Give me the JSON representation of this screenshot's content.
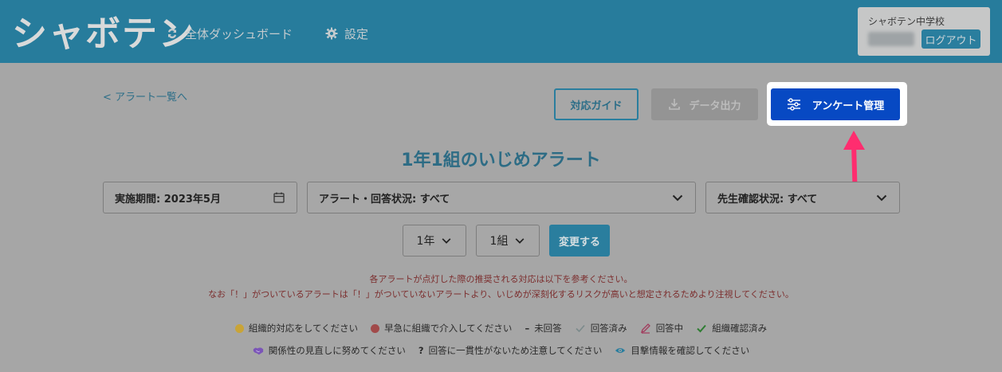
{
  "header": {
    "logo": "シャボテン",
    "nav_dashboard": "全体ダッシュボード",
    "nav_settings": "設定",
    "school_name": "シャボテン中学校",
    "logout_label": "ログアウト"
  },
  "toolbar": {
    "back_link": "< アラート一覧へ",
    "guide_label": "対応ガイド",
    "export_label": "データ出力",
    "survey_label": "アンケート管理"
  },
  "page_title": "1年1組のいじめアラート",
  "filters": {
    "period": "実施期間: 2023年5月",
    "alert_status": "アラート・回答状況: すべて",
    "teacher_status": "先生確認状況: すべて",
    "grade": "1年",
    "class": "1組",
    "change_label": "変更する"
  },
  "notice": {
    "line1": "各アラートが点灯した際の推奨される対応は以下を参考ください。",
    "line2": "なお「！」がついているアラートは「！」がついていないアラートより、いじめが深刻化するリスクが高いと想定されるためより注視してください。"
  },
  "legend": {
    "row1": [
      {
        "label": "組織的対応をしてください",
        "icon": "yellow-dot-icon",
        "color": "#c9a437"
      },
      {
        "label": "早急に組織で介入してください",
        "icon": "red-dot-icon",
        "color": "#a14a4a"
      },
      {
        "label": "未回答",
        "icon": "dash-icon",
        "symbol": "–"
      },
      {
        "label": "回答済み",
        "icon": "check-icon",
        "color": "#7b8a8b"
      },
      {
        "label": "回答中",
        "icon": "pencil-icon",
        "color": "#a13a5c"
      },
      {
        "label": "組織確認済み",
        "icon": "green-check-icon",
        "color": "#2e7d32"
      }
    ],
    "row2": [
      {
        "label": "関係性の見直しに努めてください",
        "icon": "handshake-icon",
        "color": "#7b55b8"
      },
      {
        "label": "回答に一貫性がないため注意してください",
        "icon": "question-icon",
        "symbol": "?"
      },
      {
        "label": "目撃情報を確認してください",
        "icon": "eye-icon",
        "color": "#2a7e9e"
      }
    ]
  },
  "colors": {
    "header_bg": "#277c9c",
    "primary_button": "#0749c3",
    "highlight_arrow": "#ff2d6f"
  }
}
